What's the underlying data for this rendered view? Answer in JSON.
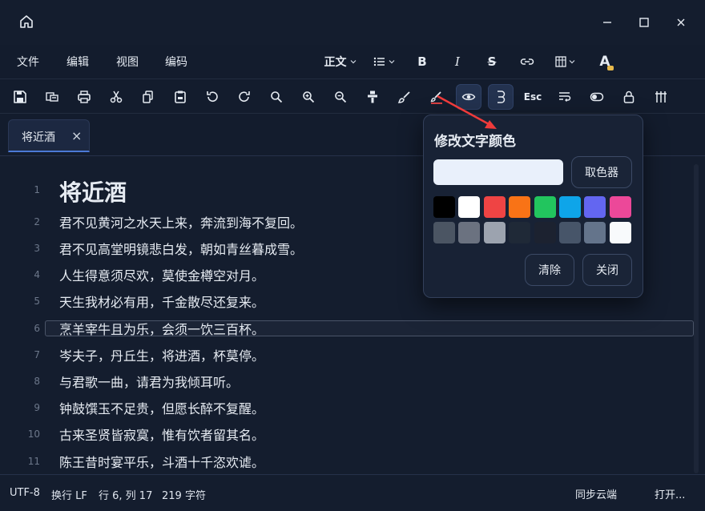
{
  "menu": [
    "文件",
    "编辑",
    "视图",
    "编码"
  ],
  "format": {
    "paragraph_label": "正文",
    "bold_label": "B",
    "italic_label": "I",
    "strike_label": "S",
    "font_color_label": "A",
    "font_color_accent": "#e7b94b"
  },
  "toolbar": {
    "esc_label": "Esc",
    "icons": [
      "save-icon",
      "save-as-icon",
      "print-icon",
      "cut-icon",
      "copy-icon",
      "paste-icon",
      "undo-icon",
      "redo-icon",
      "search-icon",
      "zoom-in-icon",
      "zoom-out-icon",
      "format-painter-icon",
      "brush-icon",
      "text-color-icon",
      "eye-icon",
      "bracket-icon",
      "esc-icon",
      "wrap-icon",
      "toggle-icon",
      "lock-icon",
      "columns-icon"
    ]
  },
  "tab": {
    "label": "将近酒",
    "close": "×"
  },
  "editor": {
    "lines": [
      {
        "num": "1",
        "text": "将近酒"
      },
      {
        "num": "2",
        "text": "君不见黄河之水天上来，奔流到海不复回。"
      },
      {
        "num": "3",
        "text": "君不见高堂明镜悲白发，朝如青丝暮成雪。"
      },
      {
        "num": "4",
        "text": "人生得意须尽欢，莫使金樽空对月。"
      },
      {
        "num": "5",
        "text": "天生我材必有用，千金散尽还复来。"
      },
      {
        "num": "6",
        "text": "烹羊宰牛且为乐，会须一饮三百杯。"
      },
      {
        "num": "7",
        "text": "岑夫子，丹丘生，将进酒，杯莫停。"
      },
      {
        "num": "8",
        "text": "与君歌一曲，请君为我倾耳听。"
      },
      {
        "num": "9",
        "text": "钟鼓馔玉不足贵，但愿长醉不复醒。"
      },
      {
        "num": "10",
        "text": "古来圣贤皆寂寞，惟有饮者留其名。"
      },
      {
        "num": "11",
        "text": "陈王昔时宴平乐，斗酒十千恣欢谑。"
      }
    ]
  },
  "status": {
    "encoding": "UTF-8",
    "line_ending": "换行 LF",
    "position": "行 6, 列 17",
    "char_count": "219 字符",
    "sync_label": "同步云端",
    "open_label": "打开..."
  },
  "color_popup": {
    "title": "修改文字颜色",
    "picker_label": "取色器",
    "clear_label": "清除",
    "close_label": "关闭",
    "input_value": "",
    "swatches_row1": [
      "#000000",
      "#ffffff",
      "#ef4444",
      "#f97316",
      "#22c55e",
      "#0ea5e9",
      "#6366f1",
      "#ec4899"
    ],
    "swatches_row2": [
      "#4b5563",
      "#6b7280",
      "#9ca3af",
      "#1f2937",
      "#1c2230",
      "#475569",
      "#64748b",
      "#f8fafc"
    ]
  }
}
